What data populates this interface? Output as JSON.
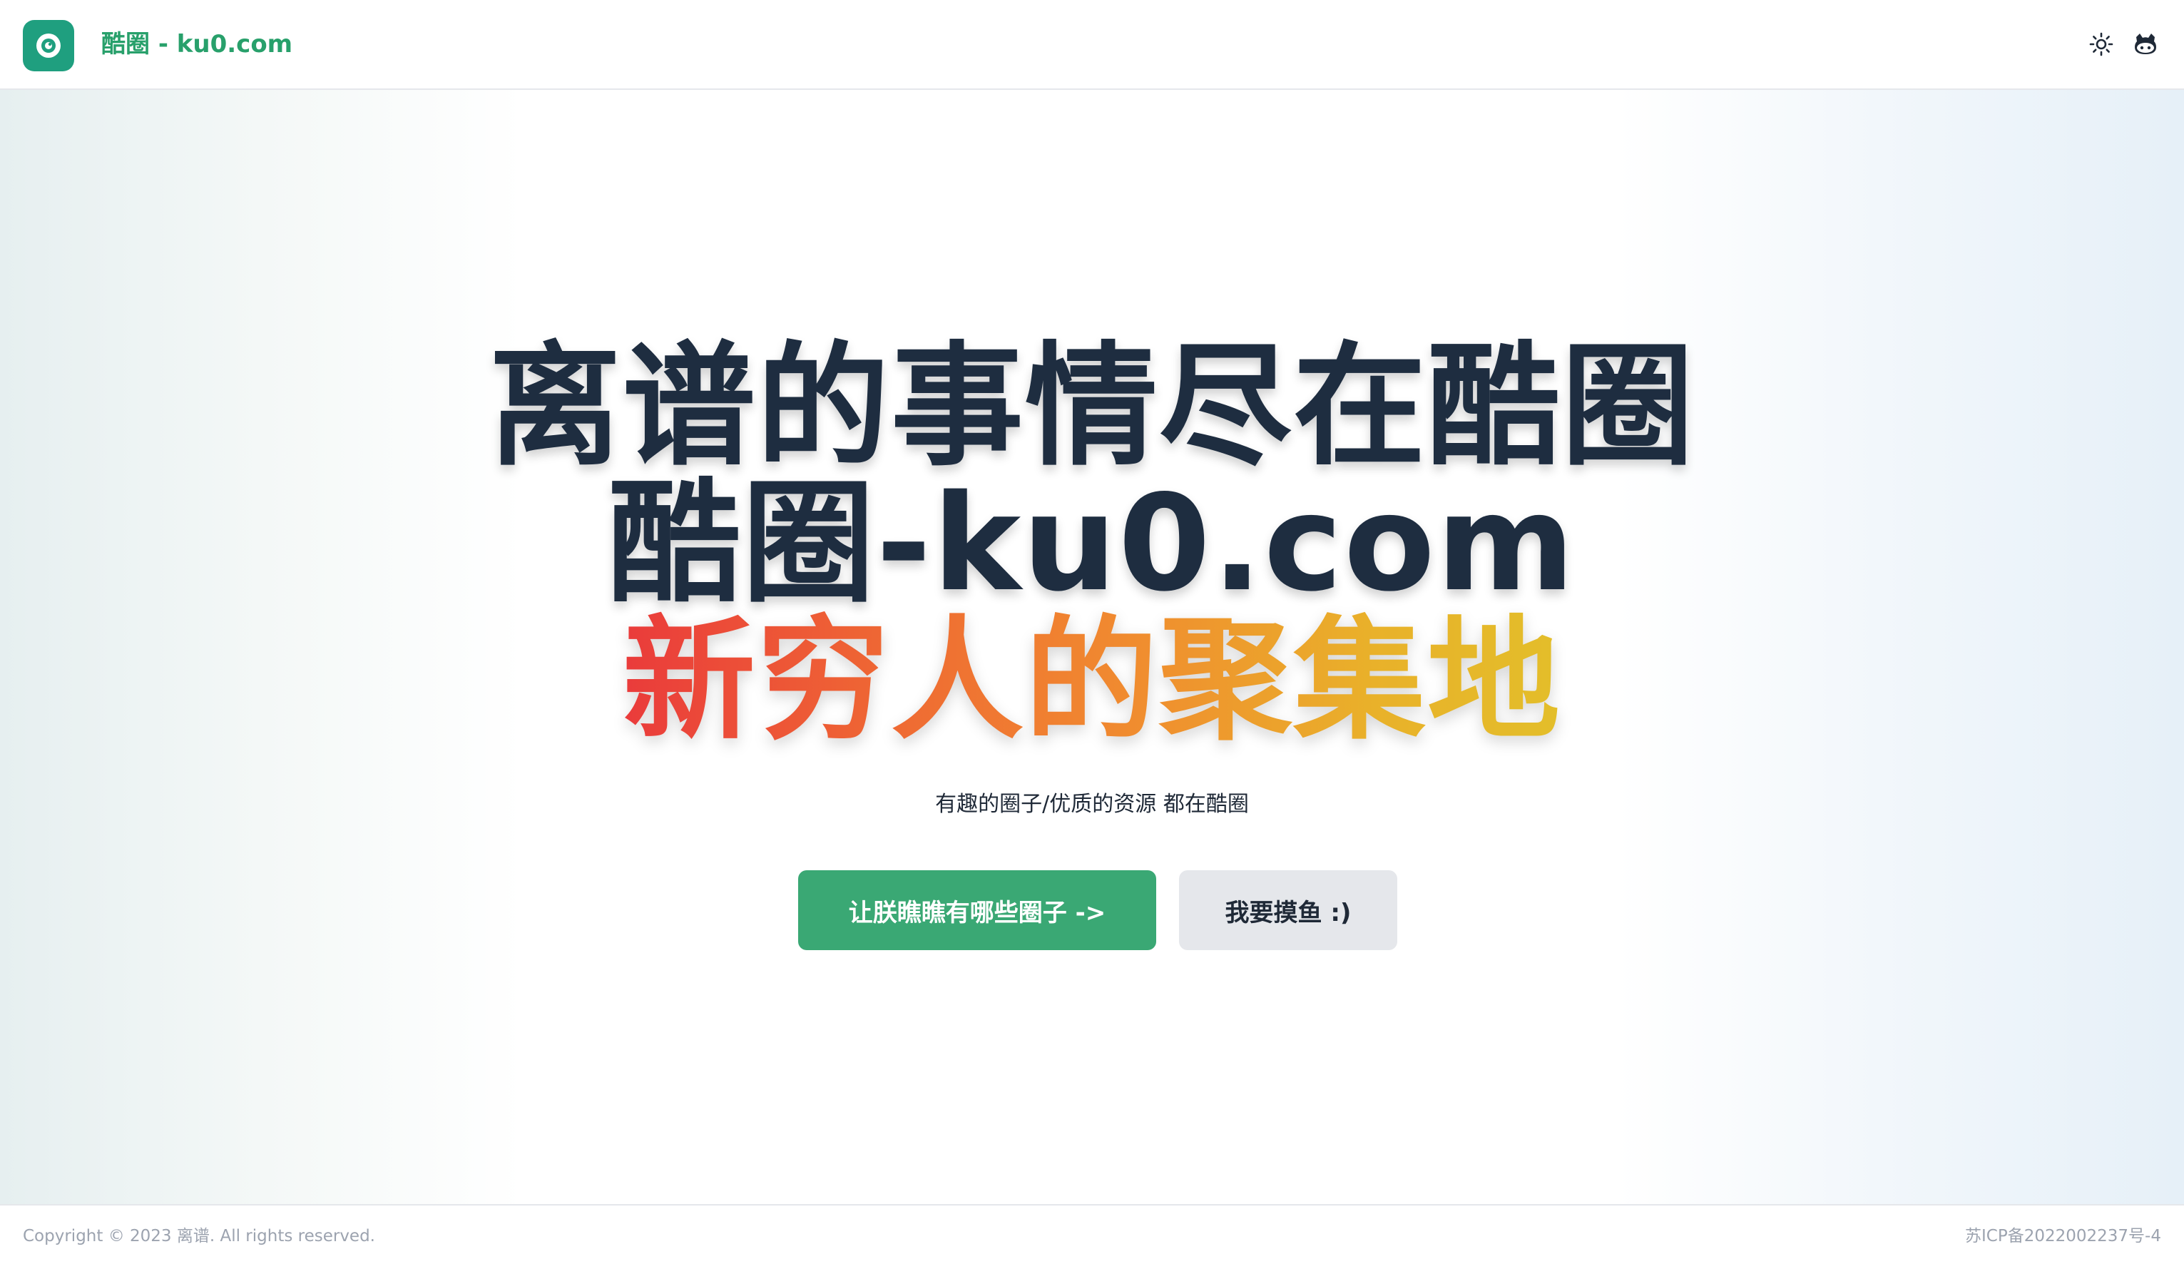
{
  "header": {
    "brand": "酷圈 - ku0.com",
    "logo_icon": "eye-circle-icon",
    "theme_icon": "sun-icon",
    "github_icon": "github-icon"
  },
  "hero": {
    "line1": "离谱的事情尽在酷圈",
    "line2": "酷圈-ku0.com",
    "line3": "新穷人的聚集地",
    "subtitle": "有趣的圈子/优质的资源 都在酷圈",
    "primary_button": "让朕瞧瞧有哪些圈子 ->",
    "secondary_button": "我要摸鱼 :)"
  },
  "footer": {
    "copyright": "Copyright © 2023 离谱. All rights reserved.",
    "icp": "苏ICP备2022002237号-4"
  },
  "colors": {
    "brand": "#28a06b",
    "logo_bg": "#1f9f7f",
    "primary_button_bg": "#3aa874",
    "secondary_button_bg": "#e5e7eb",
    "heading": "#1e2d40",
    "gradient_start": "#ea3b3b",
    "gradient_end": "#e3be2a"
  }
}
